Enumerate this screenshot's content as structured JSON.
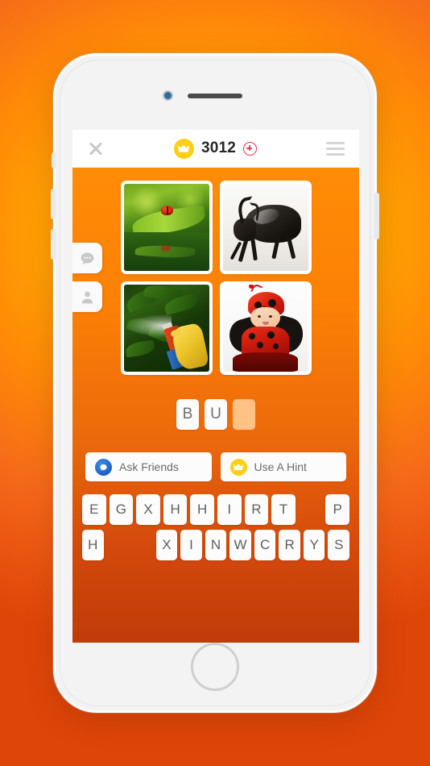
{
  "app": {
    "background_top_color": "#FFB000",
    "background_mid_color": "#FFC800",
    "background_bottom_color": "#DE4508"
  },
  "device": {
    "name": "white-smartphone",
    "camera": "front-camera",
    "speaker": "earpiece-speaker",
    "home_button": "home-button"
  },
  "topbar": {
    "close_label": "×",
    "coin_icon": "crown-coin-icon",
    "coin_count": "3012",
    "add_coins_label": "+",
    "menu_label": "menu"
  },
  "side_tabs": [
    {
      "name": "chat-tab",
      "icon": "chat-bubble-icon"
    },
    {
      "name": "profile-tab",
      "icon": "person-icon"
    }
  ],
  "puzzle": {
    "images": [
      {
        "name": "ladybug-on-leaf",
        "alt": "Ladybug on a green leaf above water"
      },
      {
        "name": "rhinoceros-beetle",
        "alt": "Black rhinoceros beetle on white background"
      },
      {
        "name": "pesticide-spray",
        "alt": "Spray can misting green plants with yellow glove"
      },
      {
        "name": "ladybug-costume-baby",
        "alt": "Toddler in a red ladybug costume"
      }
    ],
    "answer_slots": [
      {
        "letter": "B",
        "filled": true
      },
      {
        "letter": "U",
        "filled": true
      },
      {
        "letter": "",
        "filled": false
      }
    ]
  },
  "actions": [
    {
      "name": "ask-friends-button",
      "label": "Ask Friends",
      "icon": "messenger-icon",
      "icon_color": "#1B63C4"
    },
    {
      "name": "use-a-hint-button",
      "label": "Use A Hint",
      "icon": "crown-coin-icon",
      "icon_color": "#FFCE16"
    }
  ],
  "keyboard": {
    "rows": [
      [
        "E",
        "G",
        "X",
        "H",
        "H",
        "I",
        "R",
        "T",
        "",
        "P"
      ],
      [
        "H",
        "",
        "",
        "X",
        "I",
        "N",
        "W",
        "C",
        "R",
        "Y",
        "S"
      ]
    ]
  }
}
